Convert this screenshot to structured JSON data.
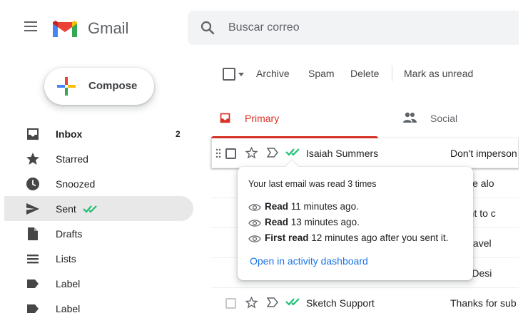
{
  "app": {
    "brand": "Gmail"
  },
  "search": {
    "placeholder": "Buscar correo"
  },
  "compose": {
    "label": "Compose"
  },
  "sidebar": {
    "items": [
      {
        "label": "Inbox",
        "icon": "inbox-icon",
        "count": "2",
        "bold": true
      },
      {
        "label": "Starred",
        "icon": "star-icon"
      },
      {
        "label": "Snoozed",
        "icon": "clock-icon"
      },
      {
        "label": "Sent",
        "icon": "send-icon",
        "active": true
      },
      {
        "label": "Drafts",
        "icon": "draft-icon"
      },
      {
        "label": "Lists",
        "icon": "list-icon"
      },
      {
        "label": "Label",
        "icon": "label-icon"
      },
      {
        "label": "Label",
        "icon": "label-icon"
      }
    ]
  },
  "toolbar": {
    "archive": "Archive",
    "spam": "Spam",
    "delete": "Delete",
    "mark_unread": "Mark as unread"
  },
  "tabs": [
    {
      "label": "Primary",
      "icon": "inbox-tab-icon",
      "active": true
    },
    {
      "label": "Social",
      "icon": "people-icon"
    }
  ],
  "emails": [
    {
      "sender": "Isaiah Summers",
      "subject": "Don't imperson"
    },
    {
      "sender": "",
      "subject": "t to be alo"
    },
    {
      "sender": "",
      "subject": "t want to c"
    },
    {
      "sender": "",
      "subject": "get travel"
    },
    {
      "sender": "",
      "subject": "tion: Desi"
    },
    {
      "sender": "Sketch Support",
      "subject": "Thanks for sub"
    }
  ],
  "read_popup": {
    "title": "Your last email was read 3 times",
    "lines": [
      {
        "bold": "Read",
        "text": " 11 minutes ago."
      },
      {
        "bold": "Read",
        "text": " 13 minutes ago."
      },
      {
        "bold": "First read",
        "text": " 12 minutes ago after you sent it."
      }
    ],
    "link": "Open in activity dashboard"
  },
  "colors": {
    "accent_red": "#d93025",
    "read_green": "#1fbf73",
    "link_blue": "#1a73e8",
    "active_bg": "#e8e8e8"
  }
}
